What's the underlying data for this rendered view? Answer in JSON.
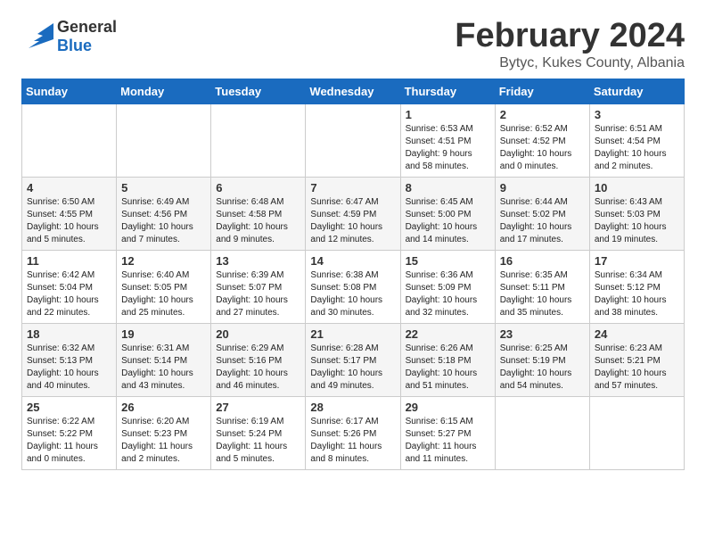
{
  "logo": {
    "general": "General",
    "blue": "Blue"
  },
  "title": {
    "month_year": "February 2024",
    "location": "Bytyc, Kukes County, Albania"
  },
  "days_of_week": [
    "Sunday",
    "Monday",
    "Tuesday",
    "Wednesday",
    "Thursday",
    "Friday",
    "Saturday"
  ],
  "weeks": [
    {
      "shaded": false,
      "days": [
        {
          "num": "",
          "info": ""
        },
        {
          "num": "",
          "info": ""
        },
        {
          "num": "",
          "info": ""
        },
        {
          "num": "",
          "info": ""
        },
        {
          "num": "1",
          "info": "Sunrise: 6:53 AM\nSunset: 4:51 PM\nDaylight: 9 hours\nand 58 minutes."
        },
        {
          "num": "2",
          "info": "Sunrise: 6:52 AM\nSunset: 4:52 PM\nDaylight: 10 hours\nand 0 minutes."
        },
        {
          "num": "3",
          "info": "Sunrise: 6:51 AM\nSunset: 4:54 PM\nDaylight: 10 hours\nand 2 minutes."
        }
      ]
    },
    {
      "shaded": true,
      "days": [
        {
          "num": "4",
          "info": "Sunrise: 6:50 AM\nSunset: 4:55 PM\nDaylight: 10 hours\nand 5 minutes."
        },
        {
          "num": "5",
          "info": "Sunrise: 6:49 AM\nSunset: 4:56 PM\nDaylight: 10 hours\nand 7 minutes."
        },
        {
          "num": "6",
          "info": "Sunrise: 6:48 AM\nSunset: 4:58 PM\nDaylight: 10 hours\nand 9 minutes."
        },
        {
          "num": "7",
          "info": "Sunrise: 6:47 AM\nSunset: 4:59 PM\nDaylight: 10 hours\nand 12 minutes."
        },
        {
          "num": "8",
          "info": "Sunrise: 6:45 AM\nSunset: 5:00 PM\nDaylight: 10 hours\nand 14 minutes."
        },
        {
          "num": "9",
          "info": "Sunrise: 6:44 AM\nSunset: 5:02 PM\nDaylight: 10 hours\nand 17 minutes."
        },
        {
          "num": "10",
          "info": "Sunrise: 6:43 AM\nSunset: 5:03 PM\nDaylight: 10 hours\nand 19 minutes."
        }
      ]
    },
    {
      "shaded": false,
      "days": [
        {
          "num": "11",
          "info": "Sunrise: 6:42 AM\nSunset: 5:04 PM\nDaylight: 10 hours\nand 22 minutes."
        },
        {
          "num": "12",
          "info": "Sunrise: 6:40 AM\nSunset: 5:05 PM\nDaylight: 10 hours\nand 25 minutes."
        },
        {
          "num": "13",
          "info": "Sunrise: 6:39 AM\nSunset: 5:07 PM\nDaylight: 10 hours\nand 27 minutes."
        },
        {
          "num": "14",
          "info": "Sunrise: 6:38 AM\nSunset: 5:08 PM\nDaylight: 10 hours\nand 30 minutes."
        },
        {
          "num": "15",
          "info": "Sunrise: 6:36 AM\nSunset: 5:09 PM\nDaylight: 10 hours\nand 32 minutes."
        },
        {
          "num": "16",
          "info": "Sunrise: 6:35 AM\nSunset: 5:11 PM\nDaylight: 10 hours\nand 35 minutes."
        },
        {
          "num": "17",
          "info": "Sunrise: 6:34 AM\nSunset: 5:12 PM\nDaylight: 10 hours\nand 38 minutes."
        }
      ]
    },
    {
      "shaded": true,
      "days": [
        {
          "num": "18",
          "info": "Sunrise: 6:32 AM\nSunset: 5:13 PM\nDaylight: 10 hours\nand 40 minutes."
        },
        {
          "num": "19",
          "info": "Sunrise: 6:31 AM\nSunset: 5:14 PM\nDaylight: 10 hours\nand 43 minutes."
        },
        {
          "num": "20",
          "info": "Sunrise: 6:29 AM\nSunset: 5:16 PM\nDaylight: 10 hours\nand 46 minutes."
        },
        {
          "num": "21",
          "info": "Sunrise: 6:28 AM\nSunset: 5:17 PM\nDaylight: 10 hours\nand 49 minutes."
        },
        {
          "num": "22",
          "info": "Sunrise: 6:26 AM\nSunset: 5:18 PM\nDaylight: 10 hours\nand 51 minutes."
        },
        {
          "num": "23",
          "info": "Sunrise: 6:25 AM\nSunset: 5:19 PM\nDaylight: 10 hours\nand 54 minutes."
        },
        {
          "num": "24",
          "info": "Sunrise: 6:23 AM\nSunset: 5:21 PM\nDaylight: 10 hours\nand 57 minutes."
        }
      ]
    },
    {
      "shaded": false,
      "days": [
        {
          "num": "25",
          "info": "Sunrise: 6:22 AM\nSunset: 5:22 PM\nDaylight: 11 hours\nand 0 minutes."
        },
        {
          "num": "26",
          "info": "Sunrise: 6:20 AM\nSunset: 5:23 PM\nDaylight: 11 hours\nand 2 minutes."
        },
        {
          "num": "27",
          "info": "Sunrise: 6:19 AM\nSunset: 5:24 PM\nDaylight: 11 hours\nand 5 minutes."
        },
        {
          "num": "28",
          "info": "Sunrise: 6:17 AM\nSunset: 5:26 PM\nDaylight: 11 hours\nand 8 minutes."
        },
        {
          "num": "29",
          "info": "Sunrise: 6:15 AM\nSunset: 5:27 PM\nDaylight: 11 hours\nand 11 minutes."
        },
        {
          "num": "",
          "info": ""
        },
        {
          "num": "",
          "info": ""
        }
      ]
    }
  ]
}
